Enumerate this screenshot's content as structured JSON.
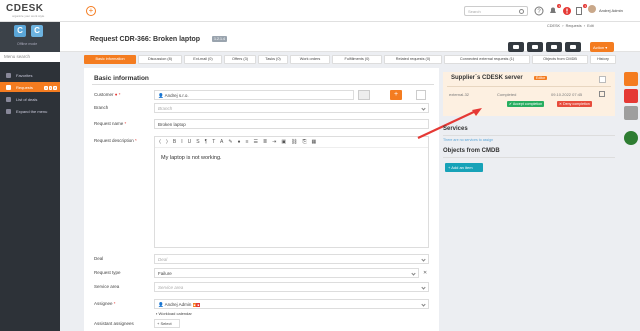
{
  "app": {
    "brand": "CDESK",
    "tagline": "organize your work style"
  },
  "topbar": {
    "search_placeholder": "Search",
    "user_name": "Andrej Admin",
    "badge_1": "1",
    "badge_2": "1"
  },
  "breadcrumb": {
    "items": [
      "CDESK",
      "Requests",
      "Edit"
    ]
  },
  "sidebar": {
    "head_label": "Offline mode",
    "search_label": "Menu search",
    "items": [
      {
        "label": "Favorites"
      },
      {
        "label": "Requests",
        "badges": [
          "4",
          "1",
          "8"
        ]
      },
      {
        "label": "List of deals"
      },
      {
        "label": "Expand the menu"
      }
    ]
  },
  "header": {
    "title": "Request CDR-366: Broken laptop",
    "badge": "1.2.1.4",
    "action_label": "Action"
  },
  "tabs": [
    {
      "label": "Basic information"
    },
    {
      "label": "Discussion (8)"
    },
    {
      "label": "Ext-mail (0)"
    },
    {
      "label": "Offers (3)"
    },
    {
      "label": "Tasks (0)"
    },
    {
      "label": "Work orders"
    },
    {
      "label": "Fulfillments (0)"
    },
    {
      "label": "Related requests (0)"
    },
    {
      "label": "Connected external requests (1)"
    },
    {
      "label": "Objects from CMDB"
    },
    {
      "label": "History"
    }
  ],
  "form": {
    "section_title": "Basic information",
    "customer_label": "Customer",
    "customer_value": "Andrej s.r.o.",
    "branch_label": "Branch",
    "branch_placeholder": "Branch",
    "request_name_label": "Request name",
    "request_name_value": "Broken laptop",
    "description_label": "Request description",
    "description_text": "My laptop is not working.",
    "deal_label": "Deal",
    "deal_placeholder": "Deal",
    "request_type_label": "Request type",
    "request_type_value": "Failure",
    "service_area_label": "Service area",
    "service_area_placeholder": "Service area",
    "assignee_label": "Assignee",
    "assignee_value": "Andrej Admin",
    "workload_link": "Workload calendar",
    "assistant_label": "Assistant assignees",
    "select_label": "+ Select"
  },
  "supplier": {
    "title": "Supplier`s CDESK server",
    "edit_label": "Editor",
    "ext_id": "external-32",
    "status": "Completed",
    "date": "09.10.2022 07:45",
    "accept_label": "Accept completion",
    "deny_label": "Deny completion"
  },
  "services": {
    "title": "Services",
    "empty_text": "There are no services to assign"
  },
  "cmdb": {
    "title": "Objects from CMDB",
    "add_label": "+ Add an item"
  },
  "colors": {
    "accent": "#f47c20",
    "green": "#27ae60",
    "red": "#e74c3c",
    "sidebar": "#2d3238",
    "teal": "#17a2b8"
  }
}
